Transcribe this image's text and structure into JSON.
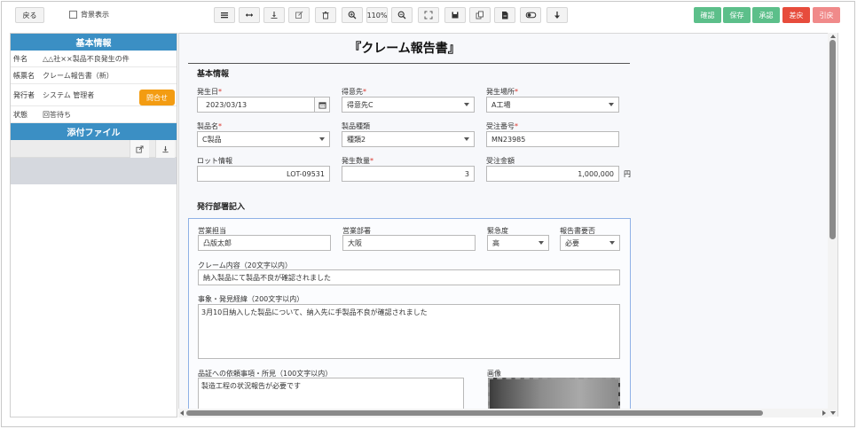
{
  "toolbar": {
    "back_label": "戻る",
    "bg_display_label": "背景表示",
    "zoom_level": "110%",
    "actions": [
      {
        "label": "確認",
        "color": "#5cbf8a"
      },
      {
        "label": "保存",
        "color": "#5cbf8a"
      },
      {
        "label": "承認",
        "color": "#5cbf8a"
      },
      {
        "label": "差戻",
        "color": "#e74c3c"
      },
      {
        "label": "引戻",
        "color": "#f08a8a"
      }
    ],
    "icons": [
      "list-icon",
      "arrows-horizontal-icon",
      "download-icon",
      "edit-icon",
      "trash-icon",
      "zoom-in-icon",
      "zoom-out-icon",
      "fit-icon",
      "save-icon",
      "copy-icon",
      "file-icon",
      "toggle-icon",
      "arrow-down-icon"
    ]
  },
  "left_panel": {
    "basic_info_title": "基本情報",
    "rows": [
      {
        "key": "件名",
        "value": "△△社××製品不良発生の件"
      },
      {
        "key": "帳票名",
        "value": "クレーム報告書（新）"
      },
      {
        "key": "発行者",
        "value": "システム 管理者"
      },
      {
        "key": "状態",
        "value": "回答待ち"
      }
    ],
    "inquiry_button": "問合せ",
    "attachments_title": "添付ファイル"
  },
  "document": {
    "title": "『クレーム報告書』",
    "basic_section": "基本情報",
    "fields": {
      "occurrence_date": {
        "label": "発生日",
        "value": "2023/03/13",
        "required": true
      },
      "customer": {
        "label": "得意先",
        "value": "得意先C",
        "required": true
      },
      "location": {
        "label": "発生場所",
        "value": "A工場",
        "required": true
      },
      "product_name": {
        "label": "製品名",
        "value": "C製品",
        "required": true
      },
      "product_type": {
        "label": "製品種類",
        "value": "種類2",
        "required": false
      },
      "order_number": {
        "label": "受注番号",
        "value": "MN23985",
        "required": true
      },
      "lot_info": {
        "label": "ロット情報",
        "value": "LOT-09531",
        "required": false
      },
      "quantity": {
        "label": "発生数量",
        "value": "3",
        "required": true
      },
      "order_amount": {
        "label": "受注金額",
        "value": "1,000,000",
        "unit": "円",
        "required": false
      }
    },
    "dept_section": "発行部署記入",
    "dept": {
      "sales_person": {
        "label": "営業担当",
        "value": "凸版太郎"
      },
      "sales_dept": {
        "label": "営業部署",
        "value": "大阪"
      },
      "urgency": {
        "label": "緊急度",
        "value": "高"
      },
      "report_needed": {
        "label": "報告書要否",
        "value": "必要"
      },
      "claim_content": {
        "label": "クレーム内容（20文字以内）",
        "value": "納入製品にて製品不良が確認されました"
      },
      "history": {
        "label": "事象・発見経緯（200文字以内）",
        "value": "3月10日納入した製品について、納入先に手製品不良が確認されました"
      },
      "request": {
        "label": "品証への依頼事項・所見（100文字以内）",
        "value": "製造工程の状況報告が必要です"
      },
      "image_label": "画像"
    }
  }
}
